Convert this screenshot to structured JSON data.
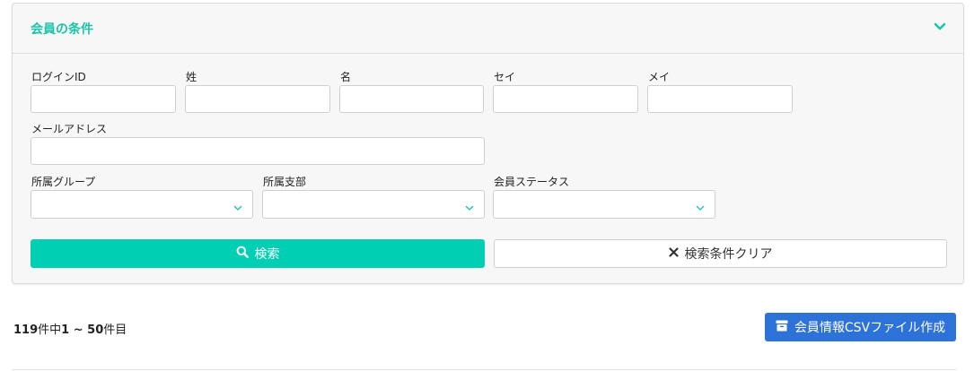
{
  "panel": {
    "title": "会員の条件",
    "toggle_icon": "chevron-down-icon",
    "accent_color": "#1bc4a8"
  },
  "fields": {
    "login_id": {
      "label": "ログインID",
      "value": ""
    },
    "last_name": {
      "label": "姓",
      "value": ""
    },
    "first_name": {
      "label": "名",
      "value": ""
    },
    "last_name_kana": {
      "label": "セイ",
      "value": ""
    },
    "first_name_kana": {
      "label": "メイ",
      "value": ""
    },
    "email": {
      "label": "メールアドレス",
      "value": ""
    },
    "group": {
      "label": "所属グループ",
      "selected": ""
    },
    "branch": {
      "label": "所属支部",
      "selected": ""
    },
    "status": {
      "label": "会員ステータス",
      "selected": ""
    }
  },
  "buttons": {
    "search": {
      "label": "検索",
      "icon": "search-icon",
      "color": "#00cfb4"
    },
    "clear": {
      "label": "検索条件クリア",
      "icon": "close-icon"
    },
    "csv": {
      "label": "会員情報CSVファイル作成",
      "icon": "archive-icon",
      "color": "#2d72d9"
    }
  },
  "results": {
    "total": "119",
    "total_suffix": "件中",
    "range": "1 ~ 50",
    "range_suffix": "件目"
  }
}
